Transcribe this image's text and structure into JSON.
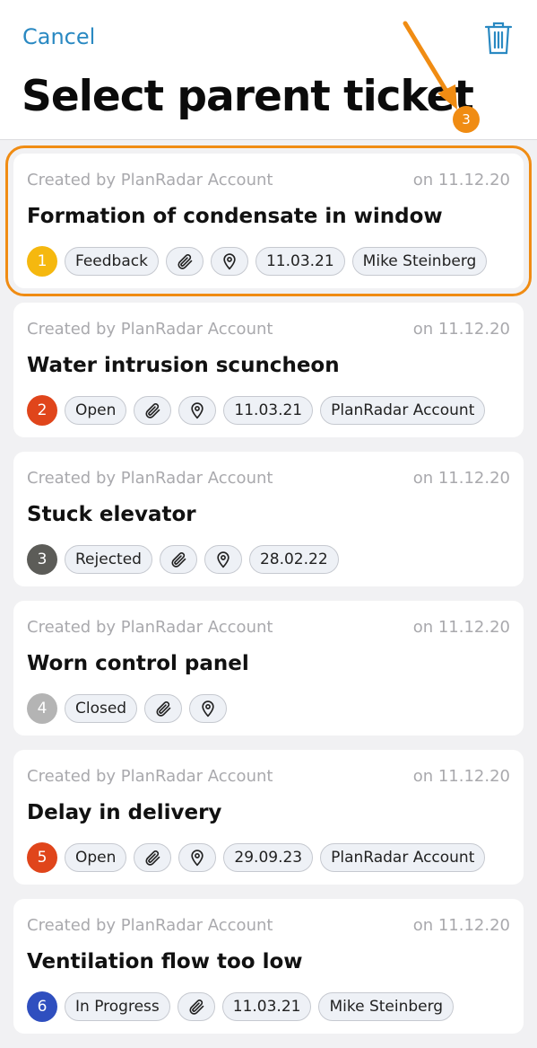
{
  "header": {
    "cancel_label": "Cancel",
    "title": "Select parent ticket",
    "annotation_number": "3",
    "accent_color": "#2a89c2",
    "annotation_color": "#f08c13"
  },
  "tickets": [
    {
      "created": "Created by PlanRadar Account",
      "date": "on 11.12.20",
      "title": "Formation of condensate in window",
      "number": "1",
      "number_color": "#f5b80f",
      "status": "Feedback",
      "due": "11.03.21",
      "assignee": "Mike Steinberg"
    },
    {
      "created": "Created by PlanRadar Account",
      "date": "on 11.12.20",
      "title": "Water intrusion scuncheon",
      "number": "2",
      "number_color": "#e0451b",
      "status": "Open",
      "due": "11.03.21",
      "assignee": "PlanRadar Account"
    },
    {
      "created": "Created by PlanRadar Account",
      "date": "on 11.12.20",
      "title": "Stuck elevator",
      "number": "3",
      "number_color": "#5c5c58",
      "status": "Rejected",
      "due": "28.02.22",
      "assignee": ""
    },
    {
      "created": "Created by PlanRadar Account",
      "date": "on 11.12.20",
      "title": "Worn control panel",
      "number": "4",
      "number_color": "#b4b4b4",
      "status": "Closed",
      "due": "",
      "assignee": ""
    },
    {
      "created": "Created by PlanRadar Account",
      "date": "on 11.12.20",
      "title": "Delay in delivery",
      "number": "5",
      "number_color": "#e0451b",
      "status": "Open",
      "due": "29.09.23",
      "assignee": "PlanRadar Account"
    },
    {
      "created": "Created by PlanRadar Account",
      "date": "on 11.12.20",
      "title": "Ventilation flow too low",
      "number": "6",
      "number_color": "#2f4fbf",
      "status": "In Progress",
      "due": "11.03.21",
      "assignee": "Mike Steinberg"
    }
  ]
}
